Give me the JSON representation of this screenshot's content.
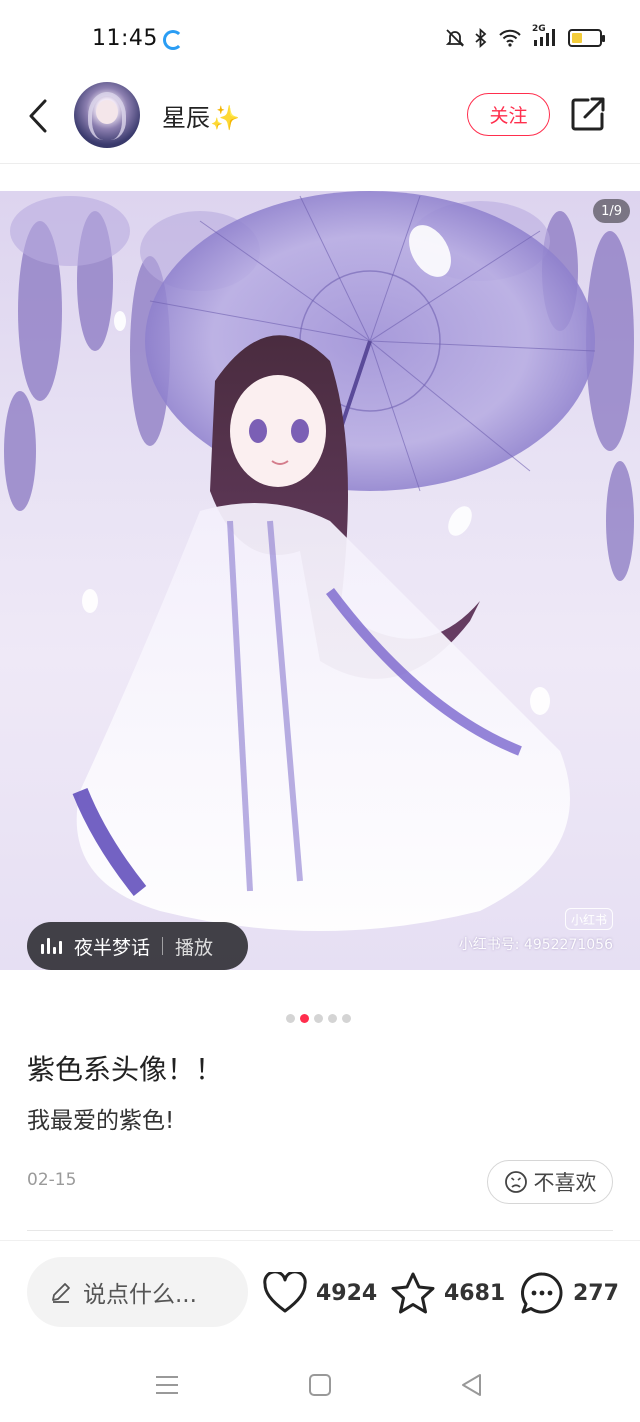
{
  "status_bar": {
    "time": "11:45",
    "network": "2G"
  },
  "header": {
    "username": "星辰✨",
    "follow_label": "关注"
  },
  "carousel": {
    "page_counter": "1/9",
    "total_pages": 9,
    "watermark_logo": "小红书",
    "watermark_id": "小红书号: 4952271056",
    "music": {
      "title": "夜半梦话",
      "play_label": "播放"
    },
    "dot_count": 5,
    "active_dot": 2
  },
  "post": {
    "title": "紫色系头像！！",
    "body": "我最爱的紫色!",
    "date": "02-15",
    "dislike_label": "不喜欢"
  },
  "bottom_bar": {
    "comment_placeholder": "说点什么...",
    "likes": "4924",
    "collects": "4681",
    "comments": "277"
  },
  "colors": {
    "accent": "#ff2e4d",
    "loader": "#2a9df4"
  }
}
